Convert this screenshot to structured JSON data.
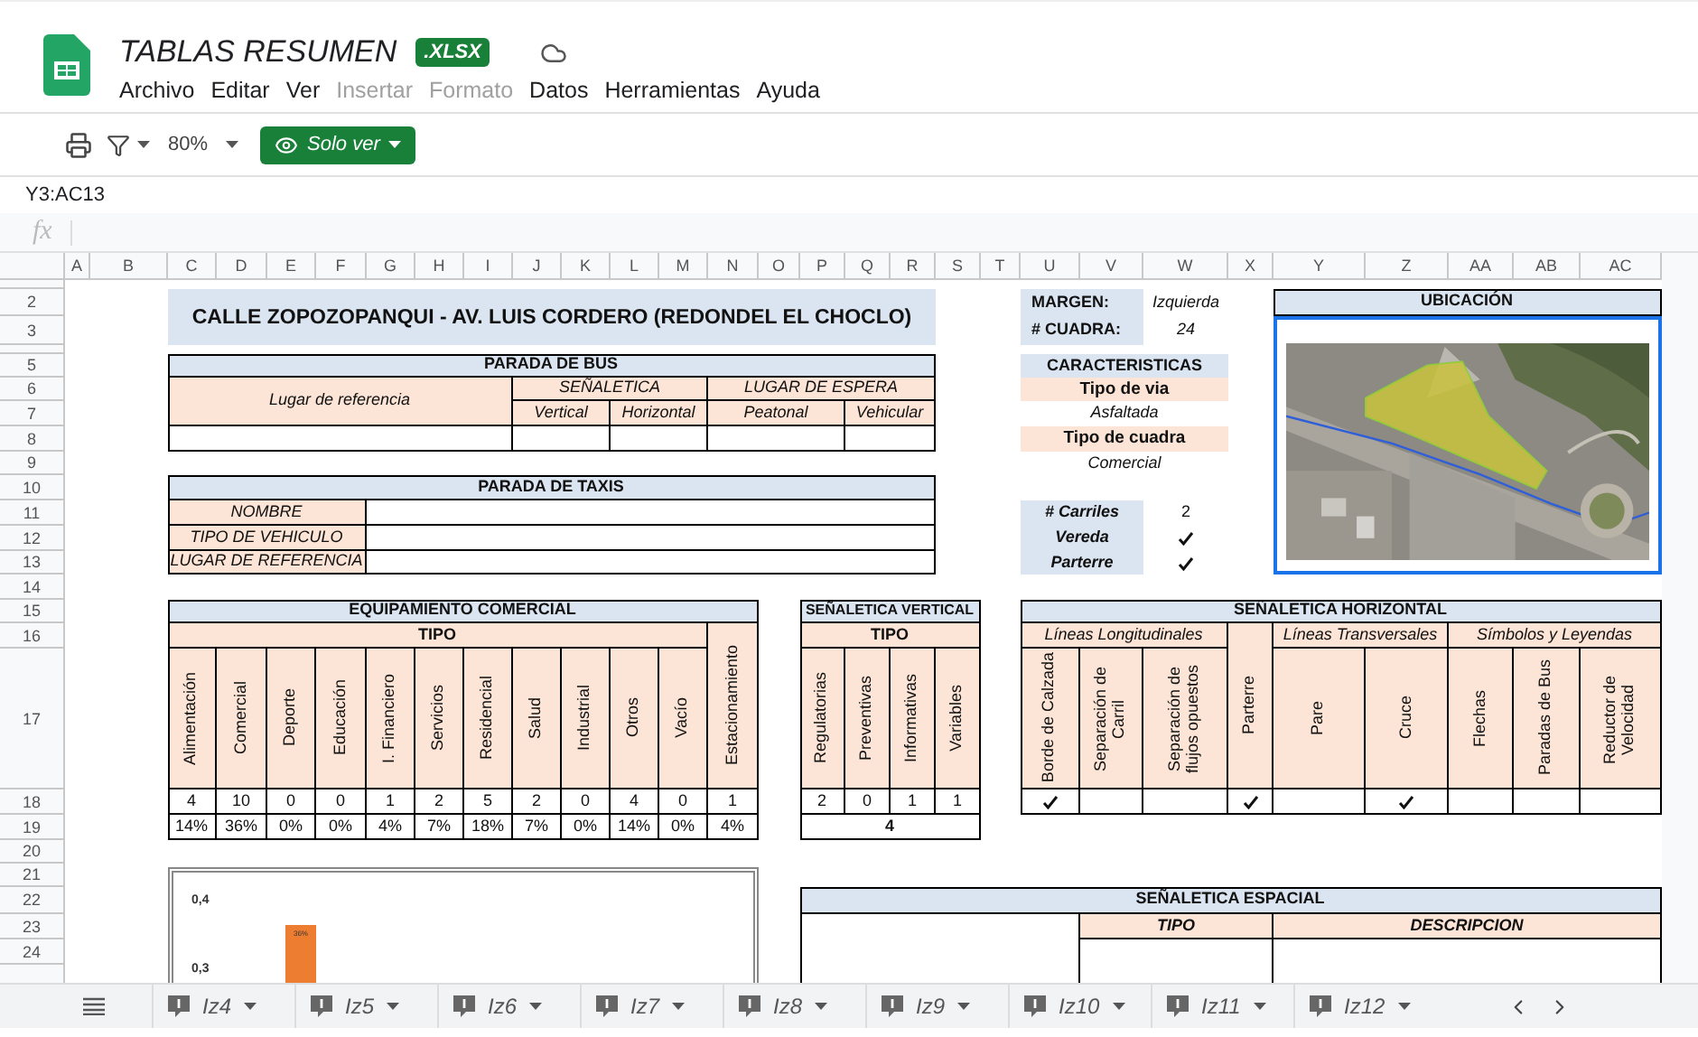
{
  "app": {
    "title": "TABLAS RESUMEN",
    "badge": ".XLSX",
    "menu": [
      {
        "label": "Archivo",
        "disabled": false
      },
      {
        "label": "Editar",
        "disabled": false
      },
      {
        "label": "Ver",
        "disabled": false
      },
      {
        "label": "Insertar",
        "disabled": true
      },
      {
        "label": "Formato",
        "disabled": true
      },
      {
        "label": "Datos",
        "disabled": false
      },
      {
        "label": "Herramientas",
        "disabled": false
      },
      {
        "label": "Ayuda",
        "disabled": false
      }
    ]
  },
  "toolbar": {
    "zoom": "80%",
    "mode": "Solo ver"
  },
  "name_box": "Y3:AC13",
  "formula_bar": {
    "icon": "fx"
  },
  "column_headers": [
    "A",
    "B",
    "C",
    "D",
    "E",
    "F",
    "G",
    "H",
    "I",
    "J",
    "K",
    "L",
    "M",
    "N",
    "O",
    "P",
    "Q",
    "R",
    "S",
    "T",
    "U",
    "V",
    "W",
    "X",
    "Y",
    "Z",
    "AA",
    "AB",
    "AC"
  ],
  "row_headers": [
    "2",
    "3",
    "5",
    "6",
    "7",
    "8",
    "9",
    "10",
    "11",
    "12",
    "13",
    "14",
    "15",
    "16",
    "17",
    "18",
    "19",
    "20",
    "21",
    "22",
    "23",
    "24"
  ],
  "sheet": {
    "title": "CALLE ZOPOZOPANQUI - AV. LUIS CORDERO (REDONDEL EL CHOCLO)",
    "bus_stop": {
      "title": "PARADA DE BUS",
      "reference": "Lugar de referencia",
      "signage": "SEÑALETICA",
      "signage_columns": [
        "Vertical",
        "Horizontal"
      ],
      "waiting": "LUGAR DE ESPERA",
      "waiting_columns": [
        "Peatonal",
        "Vehicular"
      ]
    },
    "taxi_stop": {
      "title": "PARADA DE TAXIS",
      "fields": [
        "NOMBRE",
        "TIPO DE VEHICULO",
        "LUGAR DE REFERENCIA"
      ]
    },
    "info": [
      {
        "label": "MARGEN:",
        "value": "Izquierda"
      },
      {
        "label": "# CUADRA:",
        "value": "24"
      }
    ],
    "characteristics": {
      "title": "CARACTERISTICAS",
      "items": [
        {
          "label": "Tipo de via",
          "value": "Asfaltada"
        },
        {
          "label": "Tipo de cuadra",
          "value": "Comercial"
        }
      ]
    },
    "lanes": [
      {
        "kind": "text",
        "label": "# Carriles",
        "value": "2"
      },
      {
        "kind": "check",
        "label": "Vereda",
        "checked": true
      },
      {
        "kind": "check",
        "label": "Parterre",
        "checked": true
      }
    ],
    "location": {
      "title": "UBICACIÓN"
    },
    "equipment": {
      "title": "EQUIPAMIENTO COMERCIAL",
      "group": "TIPO",
      "columns": [
        {
          "label": "Alimentación",
          "count": "4",
          "share": "14%"
        },
        {
          "label": "Comercial",
          "count": "10",
          "share": "36%"
        },
        {
          "label": "Deporte",
          "count": "0",
          "share": "0%"
        },
        {
          "label": "Educación",
          "count": "0",
          "share": "0%"
        },
        {
          "label": "I. Financiero",
          "count": "1",
          "share": "4%"
        },
        {
          "label": "Servicios",
          "count": "2",
          "share": "7%"
        },
        {
          "label": "Residencial",
          "count": "5",
          "share": "18%"
        },
        {
          "label": "Salud",
          "count": "2",
          "share": "7%"
        },
        {
          "label": "Industrial",
          "count": "0",
          "share": "0%"
        },
        {
          "label": "Otros",
          "count": "4",
          "share": "14%"
        },
        {
          "label": "Vacío",
          "count": "0",
          "share": "0%"
        }
      ],
      "parking": {
        "label": "Estacionamiento",
        "count": "1",
        "share": "4%"
      }
    },
    "vertical_signage": {
      "title": "SEÑALETICA VERTICAL",
      "group": "TIPO",
      "columns": [
        {
          "label": "Regulatorias",
          "count": "2"
        },
        {
          "label": "Preventivas",
          "count": "0"
        },
        {
          "label": "Informativas",
          "count": "1"
        },
        {
          "label": "Variables",
          "count": "1"
        }
      ],
      "total": "4"
    },
    "horizontal_signage": {
      "title": "SEÑALETICA HORIZONTAL",
      "groups": [
        {
          "kind": "group",
          "label": "Líneas Longitudinales",
          "columns": [
            {
              "label": "Borde de Calzada",
              "checked": true
            },
            {
              "label": "Separación de Carril",
              "checked": false
            },
            {
              "label": "Separación de flujos opuestos",
              "checked": false
            }
          ]
        },
        {
          "kind": "single",
          "label": "Parterre",
          "checked": true
        },
        {
          "kind": "group",
          "label": "Líneas Transversales",
          "columns": [
            {
              "label": "Pare",
              "checked": false
            },
            {
              "label": "Cruce",
              "checked": true
            }
          ]
        },
        {
          "kind": "group",
          "label": "Símbolos y Leyendas",
          "columns": [
            {
              "label": "Flechas",
              "checked": false
            },
            {
              "label": "Paradas de Bus",
              "checked": false
            },
            {
              "label": "Reductor de Velocidad",
              "checked": false
            }
          ]
        }
      ]
    },
    "chart": {
      "tick_labels": [
        "0,4",
        "0,3"
      ],
      "bar_labels": [
        "36%"
      ]
    },
    "spatial_signage": {
      "title": "SEÑALETICA ESPACIAL",
      "columns": [
        "TIPO",
        "DESCRIPCION"
      ]
    }
  },
  "sheet_tabs": [
    {
      "label": "Iz4",
      "selected": false
    },
    {
      "label": "Iz5",
      "selected": false
    },
    {
      "label": "Iz6",
      "selected": false
    },
    {
      "label": "Iz7",
      "selected": false
    },
    {
      "label": "Iz8",
      "selected": false
    },
    {
      "label": "Iz9",
      "selected": false
    },
    {
      "label": "Iz10",
      "selected": false
    },
    {
      "label": "Iz11",
      "selected": false
    },
    {
      "label": "Iz12",
      "selected": false
    }
  ]
}
